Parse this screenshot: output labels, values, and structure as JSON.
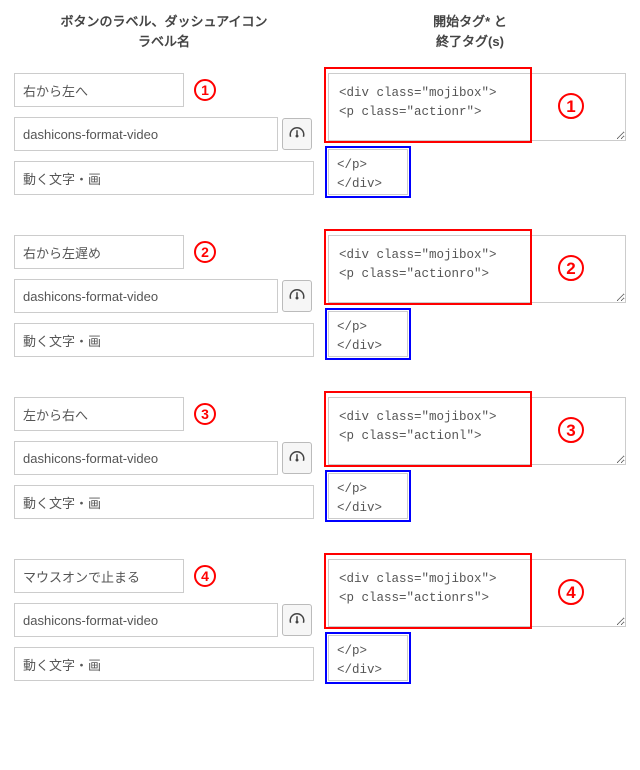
{
  "headers": {
    "left_line1": "ボタンのラベル、ダッシュアイコン",
    "left_line2": "ラベル名",
    "right_line1": "開始タグ* と",
    "right_line2": "終了タグ(s)"
  },
  "rows": [
    {
      "num": "1",
      "label": "右から左へ",
      "dashicon": "dashicons-format-video",
      "desc": "動く文字・画",
      "start_tag": "<div class=\"mojibox\">\n<p class=\"actionr\">",
      "end_tag": "</p>\n</div>"
    },
    {
      "num": "2",
      "label": "右から左遅め",
      "dashicon": "dashicons-format-video",
      "desc": "動く文字・画",
      "start_tag": "<div class=\"mojibox\">\n<p class=\"actionro\">",
      "end_tag": "</p>\n</div>"
    },
    {
      "num": "3",
      "label": "左から右へ",
      "dashicon": "dashicons-format-video",
      "desc": "動く文字・画",
      "start_tag": "<div class=\"mojibox\">\n<p class=\"actionl\">",
      "end_tag": "</p>\n</div>"
    },
    {
      "num": "4",
      "label": "マウスオンで止まる",
      "dashicon": "dashicons-format-video",
      "desc": "動く文字・画",
      "start_tag": "<div class=\"mojibox\">\n<p class=\"actionrs\">",
      "end_tag": "</p>\n</div>"
    }
  ]
}
